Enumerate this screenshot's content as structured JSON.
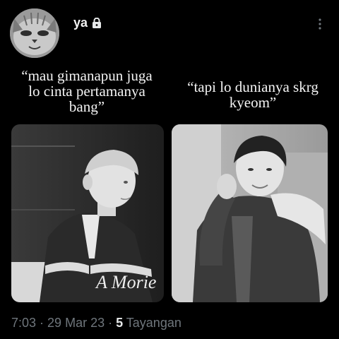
{
  "profile": {
    "username": "ya",
    "avatar_icon": "cat-face-avatar",
    "lock_icon": "lock-icon",
    "more_icon": "more-vertical-icon"
  },
  "captions": {
    "left": "“mau gimanapun juga\nlo cinta pertamanya\nbang”",
    "right": "“tapi lo dunianya skrg\nkyeom”"
  },
  "images": {
    "left_text": "A Morie"
  },
  "footer": {
    "time": "7:03",
    "separator": " · ",
    "date": "29 Mar 23",
    "views_count": "5",
    "views_label": " Tayangan"
  },
  "colors": {
    "background": "#000000",
    "text": "#e7e9ea",
    "muted": "#6f767c"
  }
}
